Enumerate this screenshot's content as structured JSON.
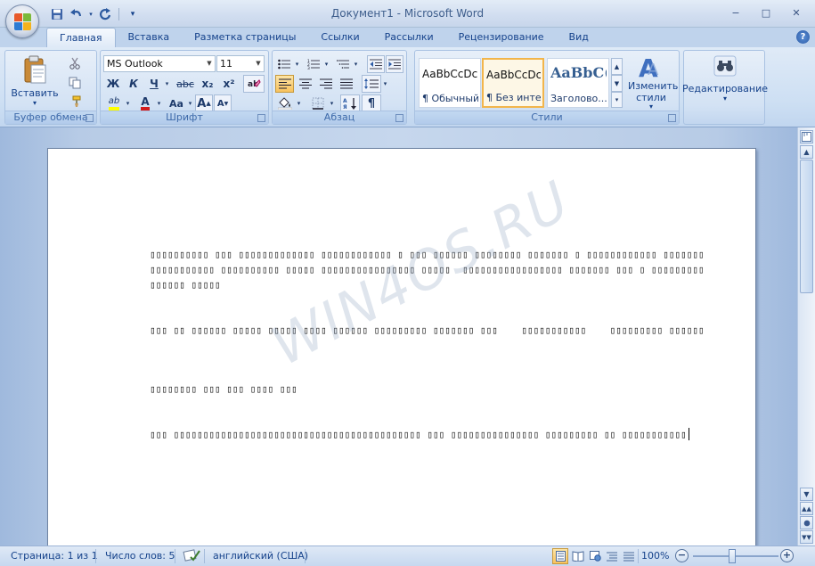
{
  "window": {
    "title": "Документ1 - Microsoft Word",
    "controls": {
      "minimize": "−",
      "maximize": "□",
      "close": "✕"
    }
  },
  "qat": {
    "save_icon": "save-icon",
    "undo_icon": "undo-icon",
    "redo_icon": "redo-icon",
    "customize_icon": "customize-qat-icon"
  },
  "tabs": [
    {
      "label": "Главная",
      "active": true
    },
    {
      "label": "Вставка"
    },
    {
      "label": "Разметка страницы"
    },
    {
      "label": "Ссылки"
    },
    {
      "label": "Рассылки"
    },
    {
      "label": "Рецензирование"
    },
    {
      "label": "Вид"
    }
  ],
  "ribbon": {
    "clipboard": {
      "label": "Буфер обмена",
      "paste_label": "Вставить",
      "paste_arrow": "▾"
    },
    "font": {
      "label": "Шрифт",
      "font_name": "MS Outlook",
      "font_size": "11",
      "bold": "Ж",
      "italic": "К",
      "underline": "Ч",
      "strike": "abc",
      "subscript": "x₂",
      "superscript": "x²",
      "grow": "A",
      "shrink": "A",
      "case": "Aa",
      "highlight": "ab",
      "font_color": "A"
    },
    "paragraph": {
      "label": "Абзац",
      "pilcrow": "¶"
    },
    "styles": {
      "label": "Стили",
      "items": [
        {
          "sample": "AaBbCcDc",
          "name": "¶ Обычный"
        },
        {
          "sample": "AaBbCcDc",
          "name": "¶ Без инте...",
          "selected": true
        },
        {
          "sample": "AaBbC(",
          "name": "Заголово..."
        }
      ],
      "change_styles_label": "Изменить стили",
      "change_arrow": "▾"
    },
    "editing": {
      "label": "Редактирование",
      "arrow": "▾"
    }
  },
  "document": {
    "watermark": "WIN4OS.RU",
    "paragraphs": [
      "▯▯▯▯▯▯▯▯▯▯ ▯▯▯ ▯▯▯▯▯▯▯▯▯▯▯▯▯ ▯▯▯▯▯▯▯▯▯▯▯▯ ▯ ▯▯▯ ▯▯▯▯▯▯ ▯▯▯▯▯▯▯▯ ▯▯▯▯▯▯▯ ▯ ▯▯▯▯▯▯▯▯▯▯▯▯ ▯▯▯▯▯▯▯▯▯▯▯▯▯▯▯▯▯▯ ▯▯▯▯▯▯▯▯▯▯ ▯▯▯▯▯ ▯▯▯▯▯▯▯▯▯▯▯▯▯▯▯▯ ▯▯▯▯▯  ▯▯▯▯▯▯▯▯▯▯▯▯▯▯▯▯▯ ▯▯▯▯▯▯▯ ▯▯▯ ▯ ▯▯▯▯▯▯▯▯▯ ▯▯▯▯▯▯ ▯▯▯▯▯",
      "▯▯▯ ▯▯ ▯▯▯▯▯▯ ▯▯▯▯▯ ▯▯▯▯▯ ▯▯▯▯ ▯▯▯▯▯▯ ▯▯▯▯▯▯▯▯▯ ▯▯▯▯▯▯▯ ▯▯▯    ▯▯▯▯▯▯▯▯▯▯▯    ▯▯▯▯▯▯▯▯▯ ▯▯▯▯▯▯",
      "▯▯▯▯▯▯▯▯ ▯▯▯ ▯▯▯ ▯▯▯▯ ▯▯▯",
      "▯▯▯ ▯▯▯▯▯▯▯▯▯▯▯▯▯▯▯▯▯▯▯▯▯▯▯▯▯▯▯▯▯▯▯▯▯▯▯▯▯▯▯▯▯▯ ▯▯▯ ▯▯▯▯▯▯▯▯▯▯▯▯▯▯▯ ▯▯▯▯▯▯▯▯▯ ▯▯ ▯▯▯▯▯▯▯▯▯▯▯"
    ]
  },
  "statusbar": {
    "page": "Страница: 1 из 1",
    "words": "Число слов: 5",
    "language": "английский (США)",
    "zoom": "100%",
    "zoom_minus": "−",
    "zoom_plus": "+"
  },
  "scrollbar": {
    "up": "▲",
    "down": "▼"
  }
}
